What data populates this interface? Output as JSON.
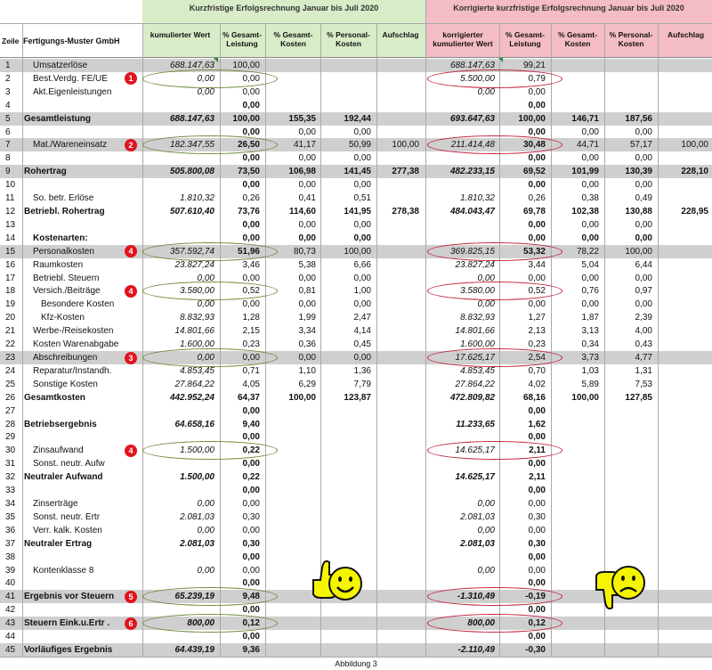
{
  "header": {
    "title_left": "Kurzfristige Erfolgsrechnung Januar bis Juli 2020",
    "title_right": "Korrigierte kurzfristige Erfolgsrechnung Januar bis Juli 2020",
    "zeile": "Zeile",
    "company": "Fertigungs-Muster GmbH",
    "left_cols": [
      "kumulierter Wert",
      "% Gesamt-\nLeistung",
      "% Gesamt-\nKosten",
      "% Personal-\nKosten",
      "Aufschlag"
    ],
    "right_cols": [
      "korrigierter\nkumulierter Wert",
      "% Gesamt-\nLeistung",
      "% Gesamt-\nKosten",
      "% Personal-\nKosten",
      "Aufschlag"
    ]
  },
  "colors": {
    "left_header_bg": "#d8ecc8",
    "right_header_bg": "#f4bcc4",
    "green_oval": "#6a8a3a",
    "red_oval": "#c0203a",
    "badge": "#e0141e",
    "smiley": "#f5f500"
  },
  "icons": {
    "thumbs_up": "thumbs-up-smiley-icon",
    "thumbs_down": "thumbs-down-smiley-icon"
  },
  "footer": "Abbildung 3",
  "rows": [
    {
      "n": "1",
      "label": "Umsatzerlöse",
      "ind": 1,
      "bold": false,
      "bg": "gray",
      "L": [
        "688.147,63",
        "100,00",
        "",
        "",
        ""
      ],
      "R": [
        "688.147,63",
        "99,21",
        "",
        "",
        ""
      ]
    },
    {
      "n": "2",
      "label": "Best.Verdg. FE/UE",
      "ind": 1,
      "bold": false,
      "bg": "white",
      "L": [
        "0,00",
        "0,00",
        "",
        "",
        ""
      ],
      "R": [
        "5.500,00",
        "0,79",
        "",
        "",
        ""
      ]
    },
    {
      "n": "3",
      "label": "Akt.Eigenleistungen",
      "ind": 1,
      "bold": false,
      "bg": "white",
      "L": [
        "0,00",
        "0,00",
        "",
        "",
        ""
      ],
      "R": [
        "0,00",
        "0,00",
        "",
        "",
        ""
      ]
    },
    {
      "n": "4",
      "label": "",
      "ind": 0,
      "bold": false,
      "bg": "white",
      "L": [
        "",
        "0,00",
        "",
        "",
        ""
      ],
      "R": [
        "",
        "0,00",
        "",
        "",
        ""
      ]
    },
    {
      "n": "5",
      "label": "Gesamtleistung",
      "ind": 0,
      "bold": true,
      "bg": "gray",
      "L": [
        "688.147,63",
        "100,00",
        "155,35",
        "192,44",
        ""
      ],
      "R": [
        "693.647,63",
        "100,00",
        "146,71",
        "187,56",
        ""
      ]
    },
    {
      "n": "6",
      "label": "",
      "ind": 0,
      "bold": false,
      "bg": "white",
      "L": [
        "",
        "0,00",
        "0,00",
        "0,00",
        ""
      ],
      "R": [
        "",
        "0,00",
        "0,00",
        "0,00",
        ""
      ]
    },
    {
      "n": "7",
      "label": "Mat./Wareneinsatz",
      "ind": 1,
      "bold": false,
      "bg": "gray",
      "L": [
        "182.347,55",
        "26,50",
        "41,17",
        "50,99",
        "100,00"
      ],
      "R": [
        "211.414,48",
        "30,48",
        "44,71",
        "57,17",
        "100,00"
      ]
    },
    {
      "n": "8",
      "label": "",
      "ind": 0,
      "bold": false,
      "bg": "white",
      "L": [
        "",
        "0,00",
        "0,00",
        "0,00",
        ""
      ],
      "R": [
        "",
        "0,00",
        "0,00",
        "0,00",
        ""
      ]
    },
    {
      "n": "9",
      "label": "Rohertrag",
      "ind": 0,
      "bold": true,
      "bg": "gray",
      "L": [
        "505.800,08",
        "73,50",
        "106,98",
        "141,45",
        "277,38"
      ],
      "R": [
        "482.233,15",
        "69,52",
        "101,99",
        "130,39",
        "228,10"
      ]
    },
    {
      "n": "10",
      "label": "",
      "ind": 0,
      "bold": false,
      "bg": "white",
      "L": [
        "",
        "0,00",
        "0,00",
        "0,00",
        ""
      ],
      "R": [
        "",
        "0,00",
        "0,00",
        "0,00",
        ""
      ]
    },
    {
      "n": "11",
      "label": "So. betr. Erlöse",
      "ind": 1,
      "bold": false,
      "bg": "white",
      "L": [
        "1.810,32",
        "0,26",
        "0,41",
        "0,51",
        ""
      ],
      "R": [
        "1.810,32",
        "0,26",
        "0,38",
        "0,49",
        ""
      ]
    },
    {
      "n": "12",
      "label": "Betriebl. Rohertrag",
      "ind": 0,
      "bold": true,
      "bg": "white",
      "L": [
        "507.610,40",
        "73,76",
        "114,60",
        "141,95",
        "278,38"
      ],
      "R": [
        "484.043,47",
        "69,78",
        "102,38",
        "130,88",
        "228,95"
      ]
    },
    {
      "n": "13",
      "label": "",
      "ind": 0,
      "bold": false,
      "bg": "white",
      "L": [
        "",
        "0,00",
        "0,00",
        "0,00",
        ""
      ],
      "R": [
        "",
        "0,00",
        "0,00",
        "0,00",
        ""
      ]
    },
    {
      "n": "14",
      "label": "Kostenarten:",
      "ind": 1,
      "bold": true,
      "bg": "white",
      "L": [
        "",
        "0,00",
        "0,00",
        "0,00",
        ""
      ],
      "R": [
        "",
        "0,00",
        "0,00",
        "0,00",
        ""
      ]
    },
    {
      "n": "15",
      "label": "Personalkosten",
      "ind": 1,
      "bold": false,
      "bg": "gray",
      "L": [
        "357.592,74",
        "51,96",
        "80,73",
        "100,00",
        ""
      ],
      "R": [
        "369.825,15",
        "53,32",
        "78,22",
        "100,00",
        ""
      ]
    },
    {
      "n": "16",
      "label": "Raumkosten",
      "ind": 1,
      "bold": false,
      "bg": "white",
      "L": [
        "23.827,24",
        "3,46",
        "5,38",
        "6,66",
        ""
      ],
      "R": [
        "23.827,24",
        "3,44",
        "5,04",
        "6,44",
        ""
      ]
    },
    {
      "n": "17",
      "label": "Betriebl. Steuern",
      "ind": 1,
      "bold": false,
      "bg": "white",
      "L": [
        "0,00",
        "0,00",
        "0,00",
        "0,00",
        ""
      ],
      "R": [
        "0,00",
        "0,00",
        "0,00",
        "0,00",
        ""
      ]
    },
    {
      "n": "18",
      "label": "Versich./Beiträge",
      "ind": 1,
      "bold": false,
      "bg": "white",
      "L": [
        "3.580,00",
        "0,52",
        "0,81",
        "1,00",
        ""
      ],
      "R": [
        "3.580,00",
        "0,52",
        "0,76",
        "0,97",
        ""
      ]
    },
    {
      "n": "19",
      "label": "Besondere Kosten",
      "ind": 2,
      "bold": false,
      "bg": "white",
      "L": [
        "0,00",
        "0,00",
        "0,00",
        "0,00",
        ""
      ],
      "R": [
        "0,00",
        "0,00",
        "0,00",
        "0,00",
        ""
      ]
    },
    {
      "n": "20",
      "label": "Kfz-Kosten",
      "ind": 2,
      "bold": false,
      "bg": "white",
      "L": [
        "8.832,93",
        "1,28",
        "1,99",
        "2,47",
        ""
      ],
      "R": [
        "8.832,93",
        "1,27",
        "1,87",
        "2,39",
        ""
      ]
    },
    {
      "n": "21",
      "label": "Werbe-/Reisekosten",
      "ind": 1,
      "bold": false,
      "bg": "white",
      "L": [
        "14.801,66",
        "2,15",
        "3,34",
        "4,14",
        ""
      ],
      "R": [
        "14.801,66",
        "2,13",
        "3,13",
        "4,00",
        ""
      ]
    },
    {
      "n": "22",
      "label": "Kosten Warenabgabe",
      "ind": 1,
      "bold": false,
      "bg": "white",
      "L": [
        "1.600,00",
        "0,23",
        "0,36",
        "0,45",
        ""
      ],
      "R": [
        "1.600,00",
        "0,23",
        "0,34",
        "0,43",
        ""
      ]
    },
    {
      "n": "23",
      "label": "Abschreibungen",
      "ind": 1,
      "bold": false,
      "bg": "gray",
      "L": [
        "0,00",
        "0,00",
        "0,00",
        "0,00",
        ""
      ],
      "R": [
        "17.625,17",
        "2,54",
        "3,73",
        "4,77",
        ""
      ]
    },
    {
      "n": "24",
      "label": "Reparatur/Instandh.",
      "ind": 1,
      "bold": false,
      "bg": "white",
      "L": [
        "4.853,45",
        "0,71",
        "1,10",
        "1,36",
        ""
      ],
      "R": [
        "4.853,45",
        "0,70",
        "1,03",
        "1,31",
        ""
      ]
    },
    {
      "n": "25",
      "label": "Sonstige Kosten",
      "ind": 1,
      "bold": false,
      "bg": "white",
      "L": [
        "27.864,22",
        "4,05",
        "6,29",
        "7,79",
        ""
      ],
      "R": [
        "27.864,22",
        "4,02",
        "5,89",
        "7,53",
        ""
      ]
    },
    {
      "n": "26",
      "label": "Gesamtkosten",
      "ind": 0,
      "bold": true,
      "bg": "white",
      "L": [
        "442.952,24",
        "64,37",
        "100,00",
        "123,87",
        ""
      ],
      "R": [
        "472.809,82",
        "68,16",
        "100,00",
        "127,85",
        ""
      ]
    },
    {
      "n": "27",
      "label": "",
      "ind": 0,
      "bold": false,
      "bg": "white",
      "L": [
        "",
        "0,00",
        "",
        "",
        ""
      ],
      "R": [
        "",
        "0,00",
        "",
        "",
        ""
      ]
    },
    {
      "n": "28",
      "label": "Betriebsergebnis",
      "ind": 0,
      "bold": true,
      "bg": "white",
      "L": [
        "64.658,16",
        "9,40",
        "",
        "",
        ""
      ],
      "R": [
        "11.233,65",
        "1,62",
        "",
        "",
        ""
      ]
    },
    {
      "n": "29",
      "label": "",
      "ind": 0,
      "bold": false,
      "bg": "white",
      "L": [
        "",
        "0,00",
        "",
        "",
        ""
      ],
      "R": [
        "",
        "0,00",
        "",
        "",
        ""
      ]
    },
    {
      "n": "30",
      "label": "Zinsaufwand",
      "ind": 1,
      "bold": false,
      "bg": "white",
      "L": [
        "1.500,00",
        "0,22",
        "",
        "",
        ""
      ],
      "R": [
        "14.625,17",
        "2,11",
        "",
        "",
        ""
      ]
    },
    {
      "n": "31",
      "label": "Sonst. neutr. Aufw",
      "ind": 1,
      "bold": false,
      "bg": "white",
      "L": [
        "",
        "0,00",
        "",
        "",
        ""
      ],
      "R": [
        "",
        "0,00",
        "",
        "",
        ""
      ]
    },
    {
      "n": "32",
      "label": "Neutraler Aufwand",
      "ind": 0,
      "bold": true,
      "bg": "white",
      "L": [
        "1.500,00",
        "0,22",
        "",
        "",
        ""
      ],
      "R": [
        "14.625,17",
        "2,11",
        "",
        "",
        ""
      ]
    },
    {
      "n": "33",
      "label": "",
      "ind": 0,
      "bold": false,
      "bg": "white",
      "L": [
        "",
        "0,00",
        "",
        "",
        ""
      ],
      "R": [
        "",
        "0,00",
        "",
        "",
        ""
      ]
    },
    {
      "n": "34",
      "label": "Zinserträge",
      "ind": 1,
      "bold": false,
      "bg": "white",
      "L": [
        "0,00",
        "0,00",
        "",
        "",
        ""
      ],
      "R": [
        "0,00",
        "0,00",
        "",
        "",
        ""
      ]
    },
    {
      "n": "35",
      "label": "Sonst. neutr. Ertr",
      "ind": 1,
      "bold": false,
      "bg": "white",
      "L": [
        "2.081,03",
        "0,30",
        "",
        "",
        ""
      ],
      "R": [
        "2.081,03",
        "0,30",
        "",
        "",
        ""
      ]
    },
    {
      "n": "36",
      "label": "Verr. kalk. Kosten",
      "ind": 1,
      "bold": false,
      "bg": "white",
      "L": [
        "0,00",
        "0,00",
        "",
        "",
        ""
      ],
      "R": [
        "0,00",
        "0,00",
        "",
        "",
        ""
      ]
    },
    {
      "n": "37",
      "label": "Neutraler Ertrag",
      "ind": 0,
      "bold": true,
      "bg": "white",
      "L": [
        "2.081,03",
        "0,30",
        "",
        "",
        ""
      ],
      "R": [
        "2.081,03",
        "0,30",
        "",
        "",
        ""
      ]
    },
    {
      "n": "38",
      "label": "",
      "ind": 0,
      "bold": false,
      "bg": "white",
      "L": [
        "",
        "0,00",
        "",
        "",
        ""
      ],
      "R": [
        "",
        "0,00",
        "",
        "",
        ""
      ]
    },
    {
      "n": "39",
      "label": "Kontenklasse 8",
      "ind": 1,
      "bold": false,
      "bg": "white",
      "L": [
        "0,00",
        "0,00",
        "",
        "",
        ""
      ],
      "R": [
        "0,00",
        "0,00",
        "",
        "",
        ""
      ]
    },
    {
      "n": "40",
      "label": "",
      "ind": 0,
      "bold": false,
      "bg": "white",
      "L": [
        "",
        "0,00",
        "",
        "",
        ""
      ],
      "R": [
        "",
        "0,00",
        "",
        "",
        ""
      ]
    },
    {
      "n": "41",
      "label": "Ergebnis vor Steuern",
      "ind": 0,
      "bold": true,
      "bg": "gray",
      "L": [
        "65.239,19",
        "9,48",
        "",
        "",
        ""
      ],
      "R": [
        "-1.310,49",
        "-0,19",
        "",
        "",
        ""
      ]
    },
    {
      "n": "42",
      "label": "",
      "ind": 0,
      "bold": false,
      "bg": "white",
      "L": [
        "",
        "0,00",
        "",
        "",
        ""
      ],
      "R": [
        "",
        "0,00",
        "",
        "",
        ""
      ]
    },
    {
      "n": "43",
      "label": "Steuern Eink.u.Ertr .",
      "ind": 0,
      "bold": true,
      "bg": "gray",
      "L": [
        "800,00",
        "0,12",
        "",
        "",
        ""
      ],
      "R": [
        "800,00",
        "0,12",
        "",
        "",
        ""
      ]
    },
    {
      "n": "44",
      "label": "",
      "ind": 0,
      "bold": false,
      "bg": "white",
      "L": [
        "",
        "0,00",
        "",
        "",
        ""
      ],
      "R": [
        "",
        "0,00",
        "",
        "",
        ""
      ]
    },
    {
      "n": "45",
      "label": "Vorläufiges Ergebnis",
      "ind": 0,
      "bold": true,
      "bg": "gray",
      "L": [
        "64.439,19",
        "9,36",
        "",
        "",
        ""
      ],
      "R": [
        "-2.110,49",
        "-0,30",
        "",
        "",
        ""
      ]
    }
  ],
  "markers": [
    {
      "row": 2,
      "badge": "1"
    },
    {
      "row": 7,
      "badge": "2"
    },
    {
      "row": 15,
      "badge": "4"
    },
    {
      "row": 18,
      "badge": "4"
    },
    {
      "row": 23,
      "badge": "3"
    },
    {
      "row": 30,
      "badge": "4"
    },
    {
      "row": 41,
      "badge": "5"
    },
    {
      "row": 43,
      "badge": "6"
    }
  ]
}
